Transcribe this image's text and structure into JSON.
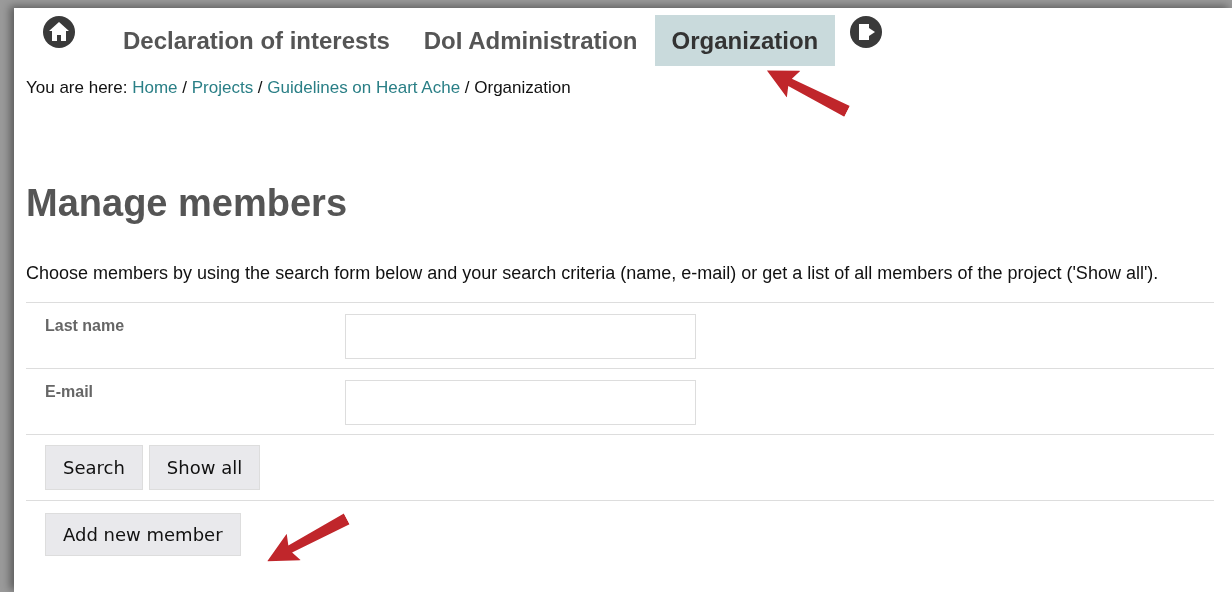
{
  "nav": {
    "tabs": [
      {
        "label": "Declaration of interests",
        "selected": false
      },
      {
        "label": "DoI Administration",
        "selected": false
      },
      {
        "label": "Organization",
        "selected": true
      }
    ]
  },
  "breadcrumb": {
    "prefix": "You are here:",
    "separator": "/",
    "items": [
      {
        "label": "Home",
        "kind": "link"
      },
      {
        "label": "Projects",
        "kind": "link"
      },
      {
        "label": "Guidelines on Heart Ache",
        "kind": "link"
      },
      {
        "label": "Organization",
        "kind": "current"
      }
    ]
  },
  "heading": "Manage members",
  "intro": "Choose members by using the search form below and your search criteria (name, e-mail) or get a list of all members of the project ('Show all').",
  "fields": [
    {
      "label": "Last name"
    },
    {
      "label": "E-mail"
    }
  ],
  "buttons": [
    "Search",
    "Show all"
  ],
  "add_button": "Add new member"
}
